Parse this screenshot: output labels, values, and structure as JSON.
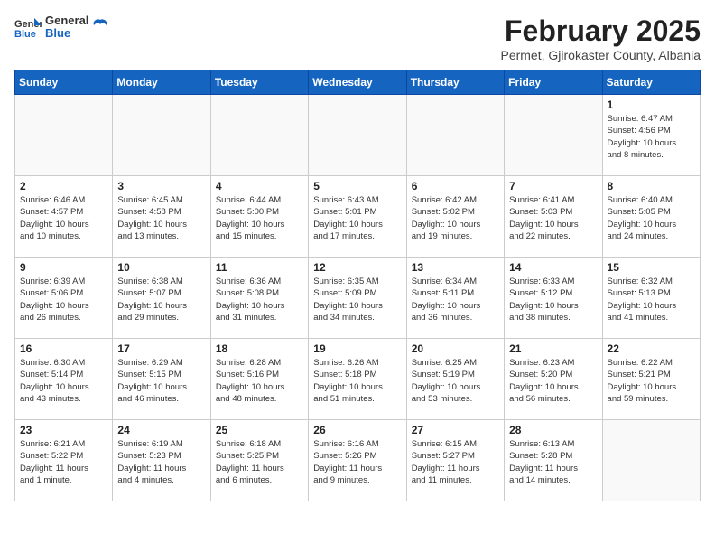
{
  "logo": {
    "general": "General",
    "blue": "Blue"
  },
  "title": "February 2025",
  "subtitle": "Permet, Gjirokaster County, Albania",
  "days_of_week": [
    "Sunday",
    "Monday",
    "Tuesday",
    "Wednesday",
    "Thursday",
    "Friday",
    "Saturday"
  ],
  "weeks": [
    [
      {
        "day": "",
        "info": ""
      },
      {
        "day": "",
        "info": ""
      },
      {
        "day": "",
        "info": ""
      },
      {
        "day": "",
        "info": ""
      },
      {
        "day": "",
        "info": ""
      },
      {
        "day": "",
        "info": ""
      },
      {
        "day": "1",
        "info": "Sunrise: 6:47 AM\nSunset: 4:56 PM\nDaylight: 10 hours\nand 8 minutes."
      }
    ],
    [
      {
        "day": "2",
        "info": "Sunrise: 6:46 AM\nSunset: 4:57 PM\nDaylight: 10 hours\nand 10 minutes."
      },
      {
        "day": "3",
        "info": "Sunrise: 6:45 AM\nSunset: 4:58 PM\nDaylight: 10 hours\nand 13 minutes."
      },
      {
        "day": "4",
        "info": "Sunrise: 6:44 AM\nSunset: 5:00 PM\nDaylight: 10 hours\nand 15 minutes."
      },
      {
        "day": "5",
        "info": "Sunrise: 6:43 AM\nSunset: 5:01 PM\nDaylight: 10 hours\nand 17 minutes."
      },
      {
        "day": "6",
        "info": "Sunrise: 6:42 AM\nSunset: 5:02 PM\nDaylight: 10 hours\nand 19 minutes."
      },
      {
        "day": "7",
        "info": "Sunrise: 6:41 AM\nSunset: 5:03 PM\nDaylight: 10 hours\nand 22 minutes."
      },
      {
        "day": "8",
        "info": "Sunrise: 6:40 AM\nSunset: 5:05 PM\nDaylight: 10 hours\nand 24 minutes."
      }
    ],
    [
      {
        "day": "9",
        "info": "Sunrise: 6:39 AM\nSunset: 5:06 PM\nDaylight: 10 hours\nand 26 minutes."
      },
      {
        "day": "10",
        "info": "Sunrise: 6:38 AM\nSunset: 5:07 PM\nDaylight: 10 hours\nand 29 minutes."
      },
      {
        "day": "11",
        "info": "Sunrise: 6:36 AM\nSunset: 5:08 PM\nDaylight: 10 hours\nand 31 minutes."
      },
      {
        "day": "12",
        "info": "Sunrise: 6:35 AM\nSunset: 5:09 PM\nDaylight: 10 hours\nand 34 minutes."
      },
      {
        "day": "13",
        "info": "Sunrise: 6:34 AM\nSunset: 5:11 PM\nDaylight: 10 hours\nand 36 minutes."
      },
      {
        "day": "14",
        "info": "Sunrise: 6:33 AM\nSunset: 5:12 PM\nDaylight: 10 hours\nand 38 minutes."
      },
      {
        "day": "15",
        "info": "Sunrise: 6:32 AM\nSunset: 5:13 PM\nDaylight: 10 hours\nand 41 minutes."
      }
    ],
    [
      {
        "day": "16",
        "info": "Sunrise: 6:30 AM\nSunset: 5:14 PM\nDaylight: 10 hours\nand 43 minutes."
      },
      {
        "day": "17",
        "info": "Sunrise: 6:29 AM\nSunset: 5:15 PM\nDaylight: 10 hours\nand 46 minutes."
      },
      {
        "day": "18",
        "info": "Sunrise: 6:28 AM\nSunset: 5:16 PM\nDaylight: 10 hours\nand 48 minutes."
      },
      {
        "day": "19",
        "info": "Sunrise: 6:26 AM\nSunset: 5:18 PM\nDaylight: 10 hours\nand 51 minutes."
      },
      {
        "day": "20",
        "info": "Sunrise: 6:25 AM\nSunset: 5:19 PM\nDaylight: 10 hours\nand 53 minutes."
      },
      {
        "day": "21",
        "info": "Sunrise: 6:23 AM\nSunset: 5:20 PM\nDaylight: 10 hours\nand 56 minutes."
      },
      {
        "day": "22",
        "info": "Sunrise: 6:22 AM\nSunset: 5:21 PM\nDaylight: 10 hours\nand 59 minutes."
      }
    ],
    [
      {
        "day": "23",
        "info": "Sunrise: 6:21 AM\nSunset: 5:22 PM\nDaylight: 11 hours\nand 1 minute."
      },
      {
        "day": "24",
        "info": "Sunrise: 6:19 AM\nSunset: 5:23 PM\nDaylight: 11 hours\nand 4 minutes."
      },
      {
        "day": "25",
        "info": "Sunrise: 6:18 AM\nSunset: 5:25 PM\nDaylight: 11 hours\nand 6 minutes."
      },
      {
        "day": "26",
        "info": "Sunrise: 6:16 AM\nSunset: 5:26 PM\nDaylight: 11 hours\nand 9 minutes."
      },
      {
        "day": "27",
        "info": "Sunrise: 6:15 AM\nSunset: 5:27 PM\nDaylight: 11 hours\nand 11 minutes."
      },
      {
        "day": "28",
        "info": "Sunrise: 6:13 AM\nSunset: 5:28 PM\nDaylight: 11 hours\nand 14 minutes."
      },
      {
        "day": "",
        "info": ""
      }
    ]
  ]
}
